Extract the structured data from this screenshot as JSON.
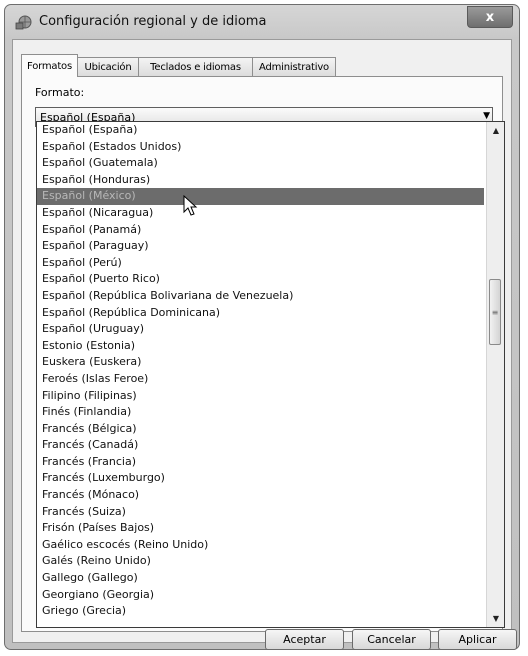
{
  "window": {
    "title": "Configuración regional y de idioma",
    "close_label": "x"
  },
  "tabs": [
    {
      "label": "Formatos",
      "active": true
    },
    {
      "label": "Ubicación",
      "active": false
    },
    {
      "label": "Teclados e idiomas",
      "active": false
    },
    {
      "label": "Administrativo",
      "active": false
    }
  ],
  "formato": {
    "label": "Formato:",
    "selected": "Español (España)"
  },
  "dropdown_items": [
    "Español (España)",
    "Español (Estados Unidos)",
    "Español (Guatemala)",
    "Español (Honduras)",
    "Español (México)",
    "Español (Nicaragua)",
    "Español (Panamá)",
    "Español (Paraguay)",
    "Español (Perú)",
    "Español (Puerto Rico)",
    "Español (República Bolivariana de Venezuela)",
    "Español (República Dominicana)",
    "Español (Uruguay)",
    "Estonio (Estonia)",
    "Euskera (Euskera)",
    "Feroés (Islas Feroe)",
    "Filipino (Filipinas)",
    "Finés (Finlandia)",
    "Francés (Bélgica)",
    "Francés (Canadá)",
    "Francés (Francia)",
    "Francés (Luxemburgo)",
    "Francés (Mónaco)",
    "Francés (Suiza)",
    "Frisón (Países Bajos)",
    "Gaélico escocés (Reino Unido)",
    "Galés (Reino Unido)",
    "Gallego (Gallego)",
    "Georgiano (Georgia)",
    "Griego (Grecia)"
  ],
  "highlighted_item": "Español (México)",
  "buttons": {
    "ok": "Aceptar",
    "cancel": "Cancelar",
    "apply": "Aplicar"
  }
}
